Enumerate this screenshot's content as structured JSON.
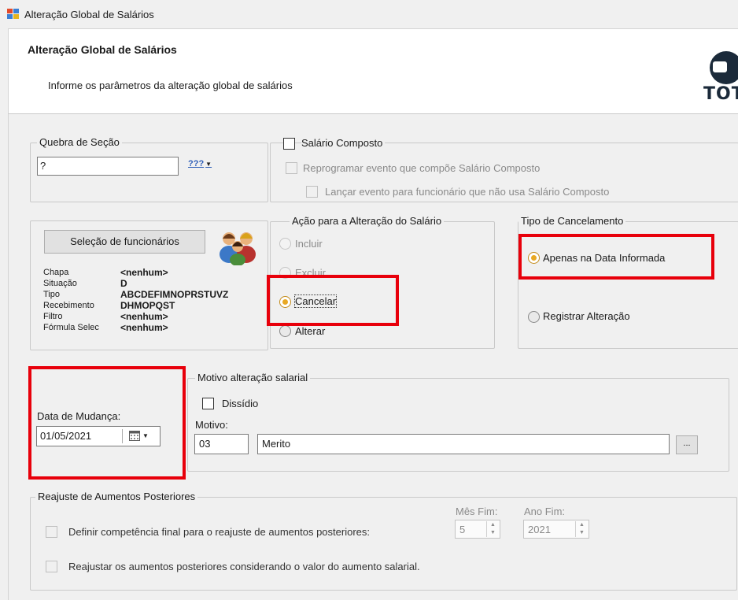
{
  "window": {
    "title": "Alteração Global de Salários"
  },
  "header": {
    "title": "Alteração Global de Salários",
    "subtitle": "Informe os parâmetros da alteração global de salários",
    "brand": "TOT"
  },
  "quebra": {
    "legend": "Quebra de Seção",
    "value": "?",
    "lookup_label": "???"
  },
  "salario_composto": {
    "label": "Salário Composto",
    "checked": false,
    "reprogramar_label": "Reprogramar evento que compõe Salário Composto",
    "lancar_label": "Lançar evento para funcionário que não usa Salário Composto"
  },
  "selecao": {
    "button_label": "Seleção de funcionários",
    "rows": [
      {
        "key": "Chapa",
        "value": "<nenhum>"
      },
      {
        "key": "Situação",
        "value": "D"
      },
      {
        "key": "Tipo",
        "value": "ABCDEFIMNOPRSTUVZ"
      },
      {
        "key": "Recebimento",
        "value": "DHMOPQST"
      },
      {
        "key": "Filtro",
        "value": "<nenhum>"
      },
      {
        "key": "Fórmula Selec",
        "value": "<nenhum>"
      }
    ]
  },
  "acao": {
    "legend": "Ação para a Alteração do Salário",
    "options": [
      {
        "label": "Incluir",
        "state": "disabled"
      },
      {
        "label": "Excluir",
        "state": "disabled"
      },
      {
        "label": "Cancelar",
        "state": "selected"
      },
      {
        "label": "Alterar",
        "state": "normal"
      }
    ]
  },
  "tipo_cancelamento": {
    "legend": "Tipo de Cancelamento",
    "options": [
      {
        "label": "Apenas na Data Informada",
        "state": "selected"
      },
      {
        "label": "Registrar Alteração",
        "state": "normal"
      }
    ]
  },
  "data_mudanca": {
    "label": "Data de Mudança:",
    "value": "01/05/2021"
  },
  "motivo": {
    "legend": "Motivo alteração salarial",
    "dissidio_label": "Dissídio",
    "motivo_label": "Motivo:",
    "code": "03",
    "description": "Merito",
    "browse_label": "..."
  },
  "reajuste": {
    "legend": "Reajuste de Aumentos Posteriores",
    "definir_label": "Definir competência final para o reajuste de aumentos posteriores:",
    "mes_label": "Mês Fim:",
    "mes_value": "5",
    "ano_label": "Ano Fim:",
    "ano_value": "2021",
    "reajustar_label": "Reajustar os aumentos posteriores considerando o valor do aumento salarial."
  },
  "colors": {
    "highlight": "#e8000b",
    "radio_selected": "#e8a823"
  }
}
